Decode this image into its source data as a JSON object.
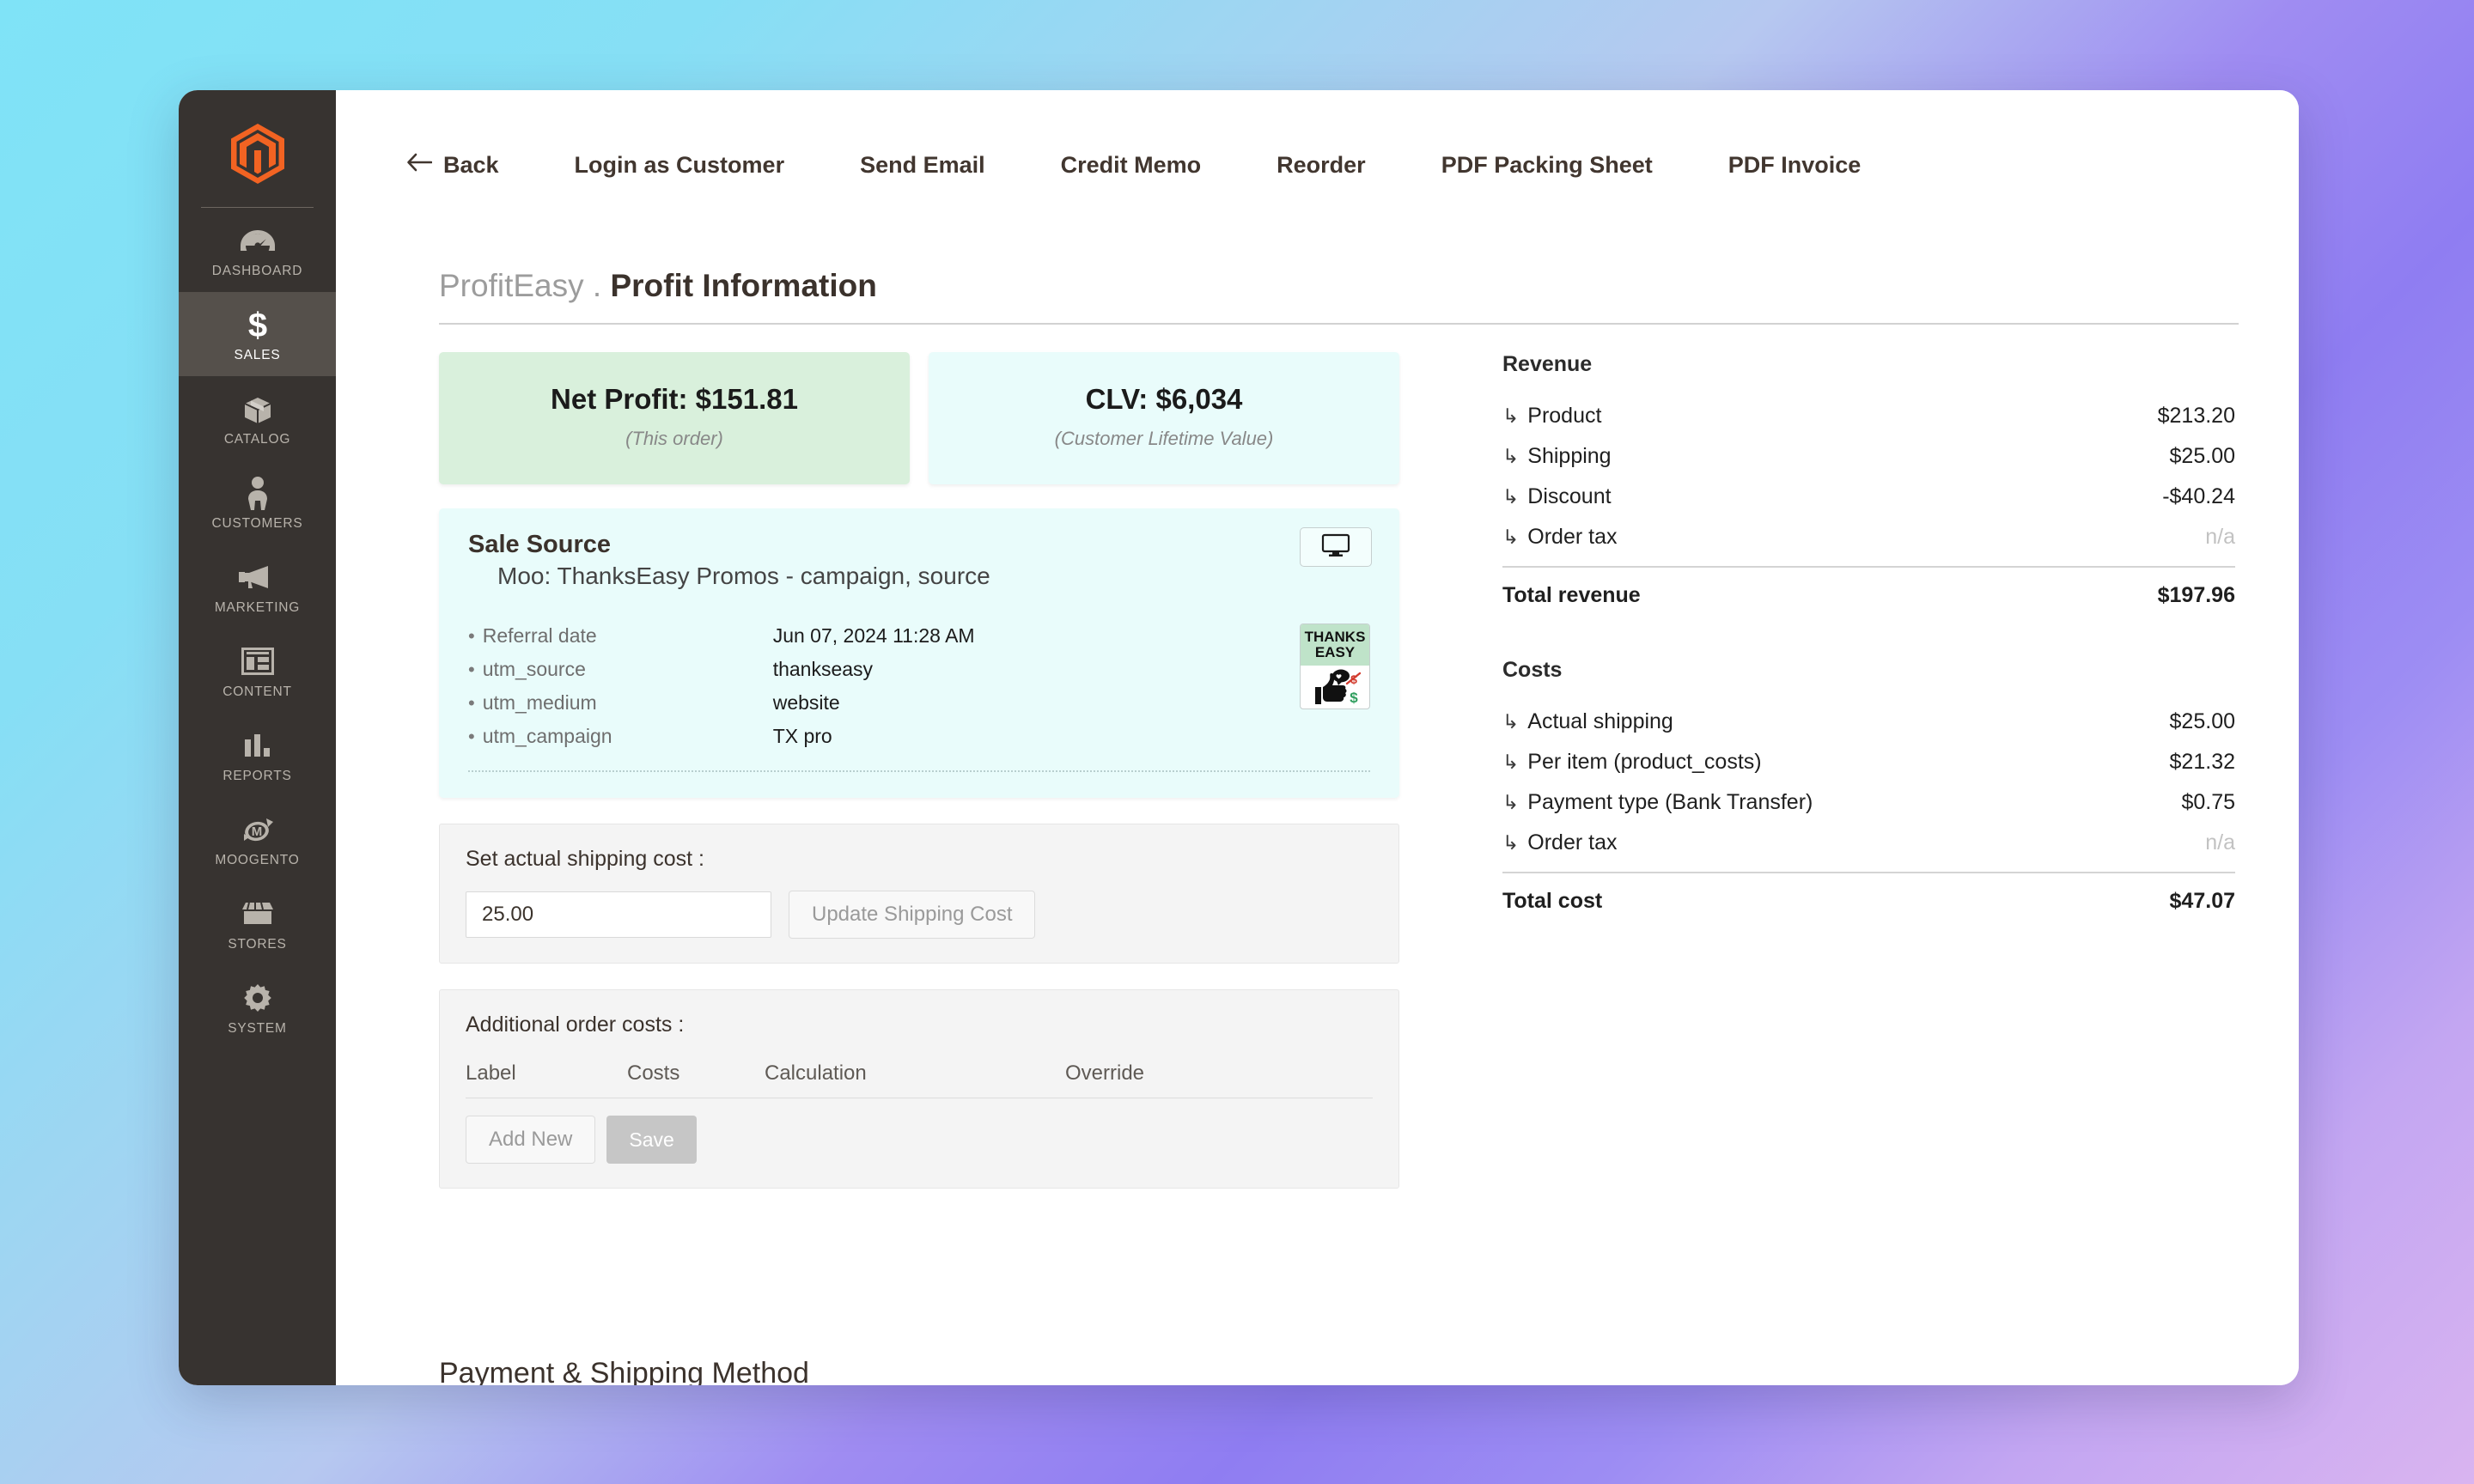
{
  "sidebar": {
    "logo_name": "magento-logo",
    "items": [
      {
        "label": "DASHBOARD",
        "icon": "gauge-icon",
        "active": false
      },
      {
        "label": "SALES",
        "icon": "dollar-icon",
        "active": true
      },
      {
        "label": "CATALOG",
        "icon": "box-icon",
        "active": false
      },
      {
        "label": "CUSTOMERS",
        "icon": "person-icon",
        "active": false
      },
      {
        "label": "MARKETING",
        "icon": "megaphone-icon",
        "active": false
      },
      {
        "label": "CONTENT",
        "icon": "layout-icon",
        "active": false
      },
      {
        "label": "REPORTS",
        "icon": "bar-chart-icon",
        "active": false
      },
      {
        "label": "MOOGENTO",
        "icon": "moogento-icon",
        "active": false
      },
      {
        "label": "STORES",
        "icon": "storefront-icon",
        "active": false
      },
      {
        "label": "SYSTEM",
        "icon": "gear-icon",
        "active": false
      }
    ]
  },
  "action_bar": {
    "back": "Back",
    "login_as_customer": "Login as Customer",
    "send_email": "Send Email",
    "credit_memo": "Credit Memo",
    "reorder": "Reorder",
    "pdf_packing_sheet": "PDF Packing Sheet",
    "pdf_invoice": "PDF Invoice"
  },
  "page_title": {
    "prefix": "ProfitEasy .",
    "main": "Profit Information"
  },
  "kpi": {
    "net_profit": {
      "value": "Net Profit: $151.81",
      "sub": "(This order)",
      "color": "#d9f0dc"
    },
    "clv": {
      "value": "CLV: $6,034",
      "sub": "(Customer Lifetime Value)",
      "color": "#e9fcfb"
    }
  },
  "sale_source": {
    "title": "Sale Source",
    "subtitle": "Moo: ThanksEasy Promos - campaign, source",
    "device_icon": "desktop-monitor-icon",
    "badge": {
      "line1": "THANKS",
      "line2": "EASY"
    },
    "attributes": [
      {
        "key": "Referral date",
        "value": "Jun 07, 2024 11:28 AM"
      },
      {
        "key": "utm_source",
        "value": "thankseasy"
      },
      {
        "key": "utm_medium",
        "value": "website"
      },
      {
        "key": "utm_campaign",
        "value": "TX pro"
      }
    ]
  },
  "shipping_panel": {
    "label": "Set actual shipping cost :",
    "input_value": "25.00",
    "input_placeholder": "0.00",
    "update_button": "Update Shipping Cost"
  },
  "additional_costs": {
    "label": "Additional order costs :",
    "columns": [
      "Label",
      "Costs",
      "Calculation",
      "Override"
    ],
    "rows": [],
    "add_new_button": "Add New",
    "save_button": "Save"
  },
  "revenue": {
    "heading": "Revenue",
    "rows": [
      {
        "label": "Product",
        "value": "$213.20",
        "na": false
      },
      {
        "label": "Shipping",
        "value": "$25.00",
        "na": false
      },
      {
        "label": "Discount",
        "value": "-$40.24",
        "na": false
      },
      {
        "label": "Order tax",
        "value": "n/a",
        "na": true
      }
    ],
    "total_label": "Total revenue",
    "total_value": "$197.96"
  },
  "costs": {
    "heading": "Costs",
    "rows": [
      {
        "label": "Actual shipping",
        "value": "$25.00",
        "na": false
      },
      {
        "label": "Per item (product_costs)",
        "value": "$21.32",
        "na": false
      },
      {
        "label": "Payment type (Bank Transfer)",
        "value": "$0.75",
        "na": false
      },
      {
        "label": "Order tax",
        "value": "n/a",
        "na": true
      }
    ],
    "total_label": "Total cost",
    "total_value": "$47.07"
  },
  "bottom_section": {
    "heading": "Payment & Shipping Method"
  }
}
